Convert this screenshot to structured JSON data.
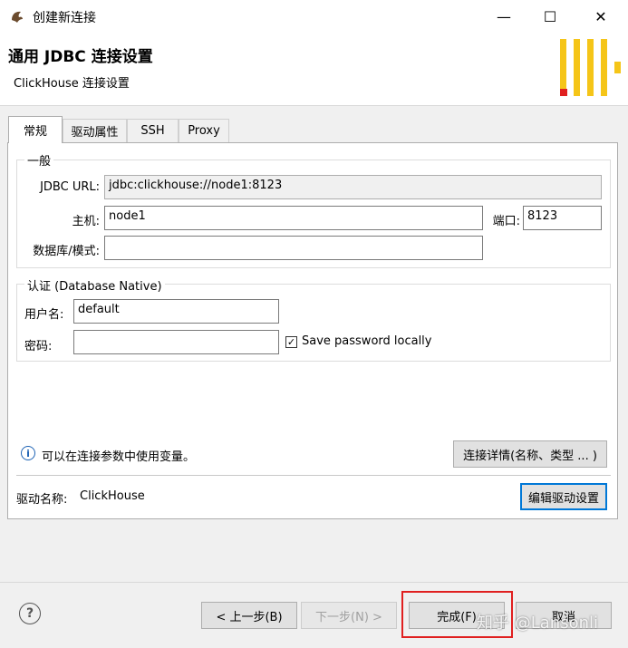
{
  "window": {
    "title": "创建新连接",
    "minimize_glyph": "—",
    "maximize_glyph": "☐",
    "close_glyph": "✕"
  },
  "header": {
    "title": "通用 JDBC 连接设置",
    "subtitle": "ClickHouse 连接设置"
  },
  "tabs": [
    {
      "label": "常规",
      "active": true
    },
    {
      "label": "驱动属性",
      "active": false
    },
    {
      "label": "SSH",
      "active": false
    },
    {
      "label": "Proxy",
      "active": false
    }
  ],
  "general": {
    "legend": "一般",
    "jdbc_url_label": "JDBC URL:",
    "jdbc_url_value": "jdbc:clickhouse://node1:8123",
    "host_label": "主机:",
    "host_value": "node1",
    "port_label": "端口:",
    "port_value": "8123",
    "database_label": "数据库/模式:",
    "database_value": ""
  },
  "auth": {
    "legend": "认证 (Database Native)",
    "username_label": "用户名:",
    "username_value": "default",
    "password_label": "密码:",
    "password_value": "",
    "save_password_label": "Save password locally",
    "save_password_checked": true
  },
  "info": {
    "variables_text": "可以在连接参数中使用变量。",
    "connection_details_button": "连接详情(名称、类型 ... )"
  },
  "driver": {
    "name_label": "驱动名称:",
    "name_value": "ClickHouse",
    "edit_button": "编辑驱动设置"
  },
  "footer": {
    "back_button": "< 上一步(B)",
    "next_button": "下一步(N) >",
    "finish_button": "完成(F)",
    "cancel_button": "取消"
  },
  "watermark": "知乎 @Lansonli",
  "colors": {
    "banner_bar": "#f5c518",
    "banner_accent": "#e02020",
    "highlight": "#e02020",
    "focus": "#0078d7"
  }
}
